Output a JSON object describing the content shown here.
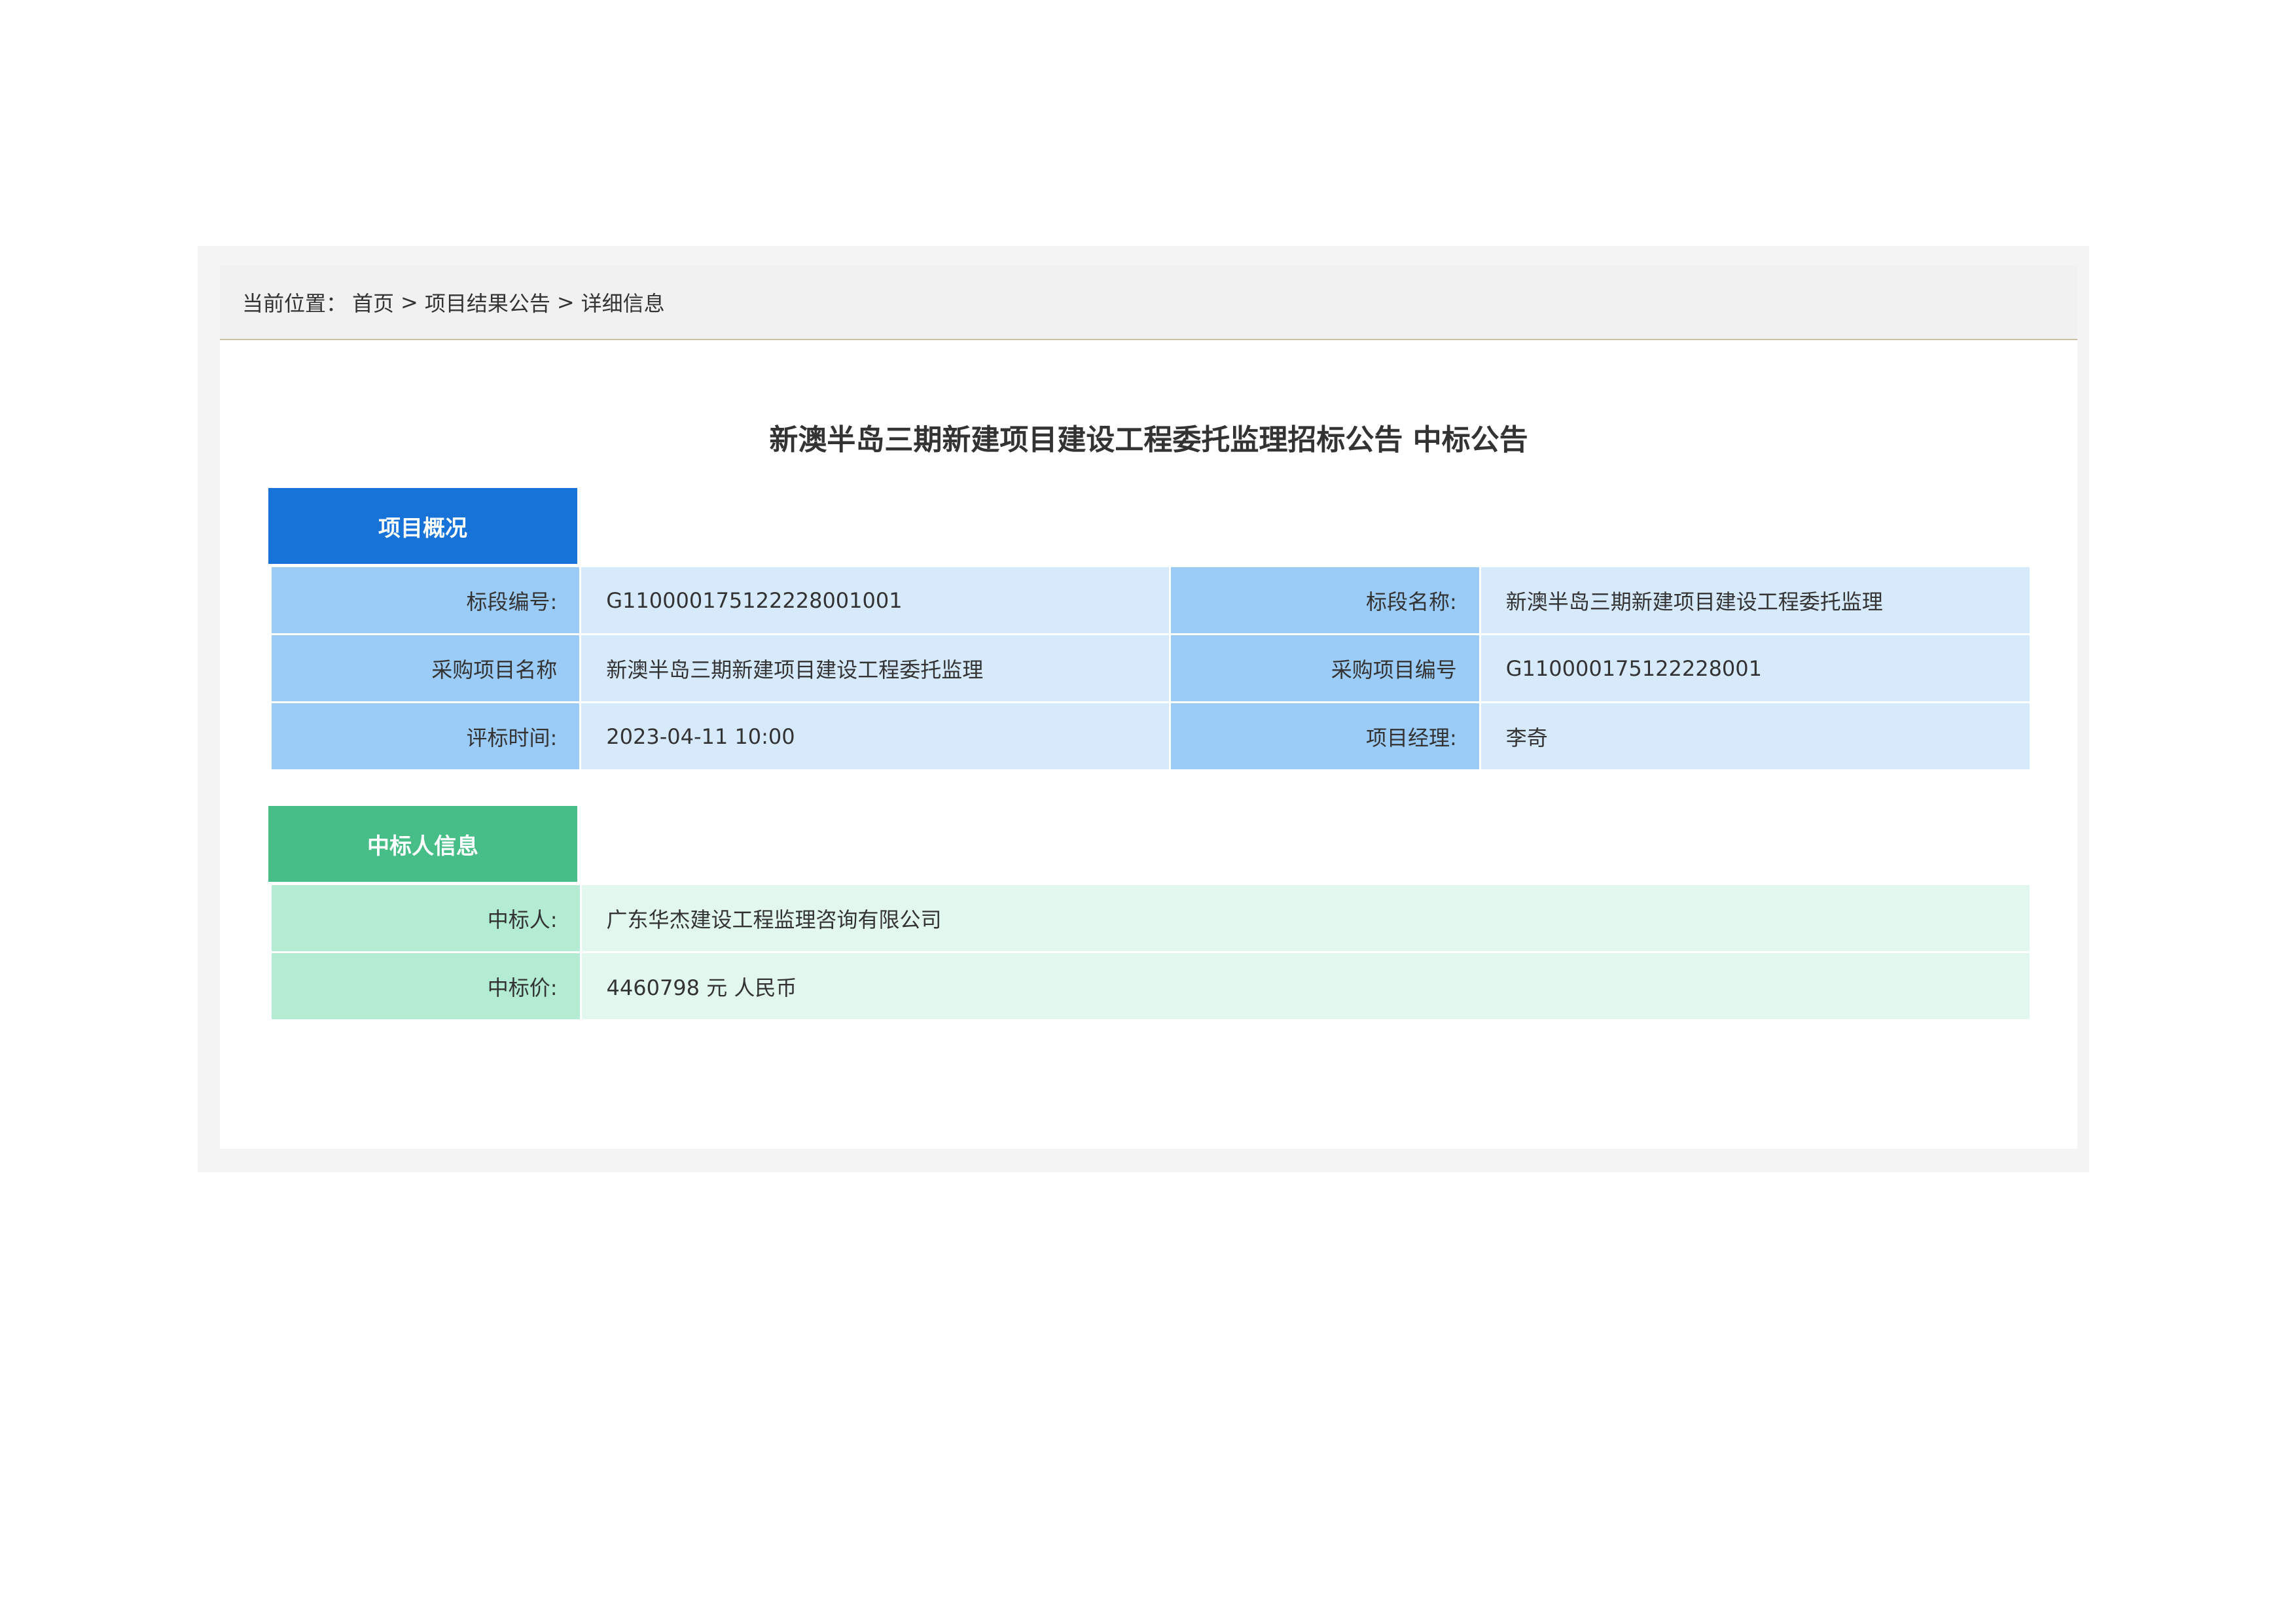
{
  "breadcrumb": {
    "prefix": "当前位置：",
    "home": "首页",
    "separator": ">",
    "category": "项目结果公告",
    "current": "详细信息"
  },
  "title": "新澳半岛三期新建项目建设工程委托监理招标公告 中标公告",
  "overview": {
    "header": "项目概况",
    "rows": [
      {
        "label1": "标段编号:",
        "value1": "G110000175122228001001",
        "label2": "标段名称:",
        "value2": "新澳半岛三期新建项目建设工程委托监理"
      },
      {
        "label1": "采购项目名称",
        "value1": "新澳半岛三期新建项目建设工程委托监理",
        "label2": "采购项目编号",
        "value2": "G110000175122228001"
      },
      {
        "label1": "评标时间:",
        "value1": "2023-04-11 10:00",
        "label2": "项目经理:",
        "value2": "李奇"
      }
    ]
  },
  "winner": {
    "header": "中标人信息",
    "rows": [
      {
        "label": "中标人:",
        "value": "广东华杰建设工程监理咨询有限公司"
      },
      {
        "label": "中标价:",
        "value": "4460798 元 人民币"
      }
    ]
  },
  "colors": {
    "overview_header": "#1873d9",
    "overview_label_bg": "#9bcbf7",
    "overview_value_bg": "#d6eafc",
    "winner_header": "#47bd87",
    "winner_label_bg": "#b3ecd2",
    "winner_value_bg": "#e2f8ee"
  }
}
